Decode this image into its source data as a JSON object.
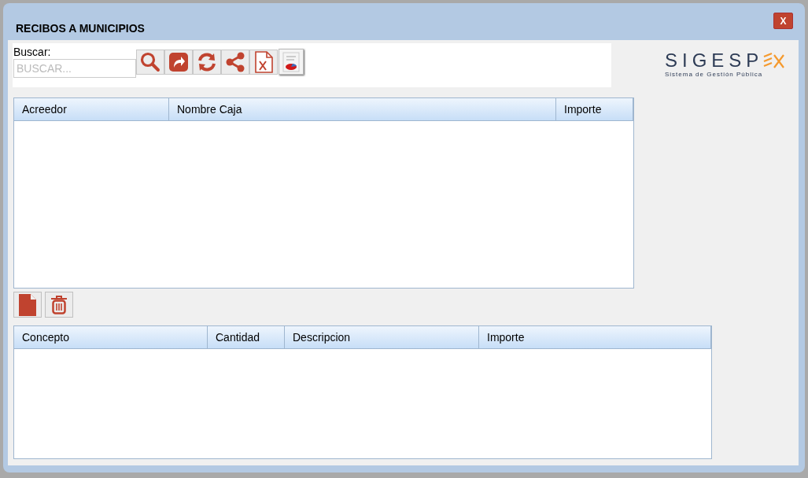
{
  "window": {
    "title": "RECIBOS A MUNICIPIOS",
    "close_label": "X"
  },
  "search": {
    "label": "Buscar:",
    "placeholder": "BUSCAR..."
  },
  "toolbar": [
    {
      "kind": "search"
    },
    {
      "kind": "forward"
    },
    {
      "kind": "refresh"
    },
    {
      "kind": "share"
    },
    {
      "kind": "excel"
    },
    {
      "kind": "report"
    }
  ],
  "logo": {
    "name": "SIGESP",
    "tagline": "Sistema de Gestión Pública"
  },
  "table_1": {
    "columns": [
      {
        "label": "Acreedor"
      },
      {
        "label": "Nombre Caja"
      },
      {
        "label": "Importe"
      }
    ]
  },
  "actions": [
    {
      "kind": "new"
    },
    {
      "kind": "delete"
    }
  ],
  "table_2": {
    "columns": [
      {
        "label": "Concepto"
      },
      {
        "label": "Cantidad"
      },
      {
        "label": "Descripcion"
      },
      {
        "label": "Importe"
      }
    ]
  }
}
